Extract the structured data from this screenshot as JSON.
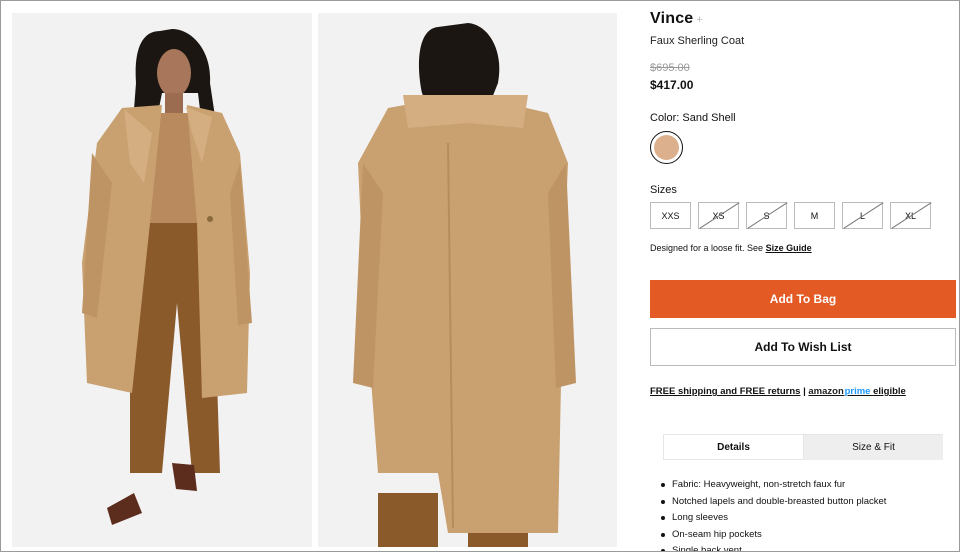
{
  "product": {
    "brand": "Vince",
    "brand_suffix": "+",
    "name": "Faux Sherling Coat",
    "original_price": "$695.00",
    "sale_price": "$417.00",
    "color_label": "Color: Sand Shell",
    "swatch_color": "#dcb08c",
    "sizes_label": "Sizes",
    "sizes": [
      {
        "label": "XXS",
        "available": true
      },
      {
        "label": "XS",
        "available": false
      },
      {
        "label": "S",
        "available": false
      },
      {
        "label": "M",
        "available": true
      },
      {
        "label": "L",
        "available": false
      },
      {
        "label": "XL",
        "available": false
      }
    ],
    "fit_note": "Designed for a loose fit.  See ",
    "size_guide_link": "Size Guide"
  },
  "actions": {
    "add_to_bag": "Add To Bag",
    "add_to_wish_list": "Add To Wish List"
  },
  "shipping": {
    "text": "FREE shipping and FREE returns",
    "separator": "|",
    "amazon": "amazon",
    "prime": "prime",
    "eligible": "eligible"
  },
  "tabs": [
    {
      "label": "Details",
      "active": true
    },
    {
      "label": "Size & Fit",
      "active": false
    }
  ],
  "details": [
    "Fabric: Heavyweight, non-stretch faux fur",
    "Notched lapels and double-breasted button placket",
    "Long sleeves",
    "On-seam hip pockets",
    "Single back vent"
  ],
  "colors": {
    "accent": "#e45a24",
    "coat": "#c9a070",
    "trousers": "#8b5a2b"
  }
}
